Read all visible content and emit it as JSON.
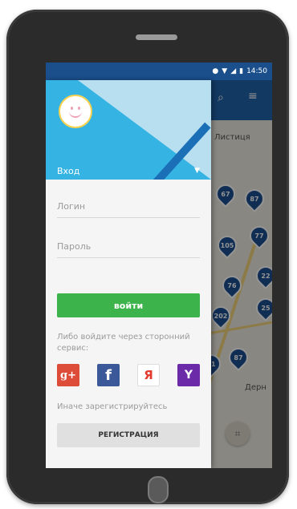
{
  "status_bar": {
    "time": "14:50",
    "icons": [
      "location-icon",
      "wifi-icon",
      "signal-icon",
      "battery-icon"
    ]
  },
  "map": {
    "label": "Листиця",
    "label2": "Дерн",
    "pins": [
      "67",
      "87",
      "105",
      "77",
      "76",
      "202",
      "22",
      "25",
      "87",
      "81"
    ]
  },
  "drawer": {
    "header_title": "Вход",
    "login_placeholder": "Логин",
    "password_placeholder": "Пароль",
    "login_button": "войти",
    "social_prompt": "Либо войдите через сторонний сервис:",
    "social": {
      "google": "g+",
      "facebook": "f",
      "yandex": "Я",
      "yahoo": "Y"
    },
    "register_prompt": "Иначе зарегистрируйтесь",
    "register_button": "РЕГИСТРАЦИЯ"
  },
  "colors": {
    "header_blue": "#35b4e3",
    "accent_green": "#3cb44b",
    "map_appbar": "#1f63a8"
  }
}
